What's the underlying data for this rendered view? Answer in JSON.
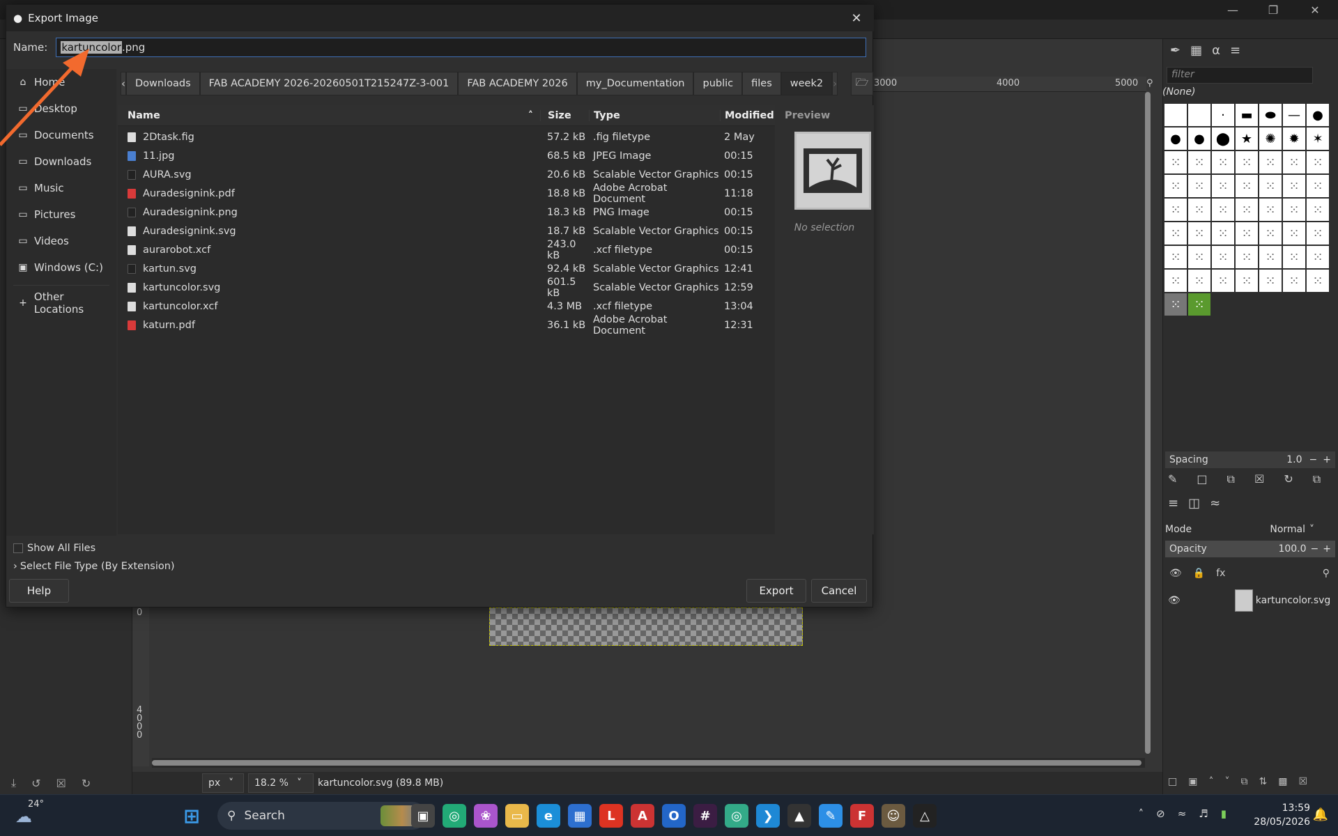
{
  "dialog": {
    "title": "Export Image",
    "name_label": "Name:",
    "name_selected": "kartuncolor",
    "name_rest": ".png",
    "places": [
      {
        "icon": "home-icon",
        "label": "Home"
      },
      {
        "icon": "folder-icon",
        "label": "Desktop"
      },
      {
        "icon": "folder-icon",
        "label": "Documents"
      },
      {
        "icon": "folder-icon",
        "label": "Downloads"
      },
      {
        "icon": "folder-icon",
        "label": "Music"
      },
      {
        "icon": "folder-icon",
        "label": "Pictures"
      },
      {
        "icon": "folder-icon",
        "label": "Videos"
      },
      {
        "icon": "drive-icon",
        "label": "Windows (C:)"
      }
    ],
    "other_locations": "Other Locations",
    "path": [
      "Downloads",
      "FAB ACADEMY 2026-20260501T215247Z-3-001",
      "FAB ACADEMY 2026",
      "my_Documentation",
      "public",
      "files",
      "week2"
    ],
    "columns": {
      "name": "Name",
      "size": "Size",
      "type": "Type",
      "modified": "Modified"
    },
    "files": [
      {
        "name": "2Dtask.fig",
        "size": "57.2 kB",
        "type": ".fig filetype",
        "modified": "2 May",
        "icon": "doc"
      },
      {
        "name": "11.jpg",
        "size": "68.5 kB",
        "type": "JPEG Image",
        "modified": "00:15",
        "icon": "img"
      },
      {
        "name": "AURA.svg",
        "size": "20.6 kB",
        "type": "Scalable Vector Graphics",
        "modified": "00:15",
        "icon": "dark"
      },
      {
        "name": "Auradesignink.pdf",
        "size": "18.8 kB",
        "type": "Adobe Acrobat Document",
        "modified": "11:18",
        "icon": "pdf"
      },
      {
        "name": "Auradesignink.png",
        "size": "18.3 kB",
        "type": "PNG Image",
        "modified": "00:15",
        "icon": "dark"
      },
      {
        "name": "Auradesignink.svg",
        "size": "18.7 kB",
        "type": "Scalable Vector Graphics",
        "modified": "00:15",
        "icon": "doc"
      },
      {
        "name": "aurarobot.xcf",
        "size": "243.0 kB",
        "type": ".xcf filetype",
        "modified": "00:15",
        "icon": "doc"
      },
      {
        "name": "kartun.svg",
        "size": "92.4 kB",
        "type": "Scalable Vector Graphics",
        "modified": "12:41",
        "icon": "dark"
      },
      {
        "name": "kartuncolor.svg",
        "size": "601.5 kB",
        "type": "Scalable Vector Graphics",
        "modified": "12:59",
        "icon": "doc"
      },
      {
        "name": "kartuncolor.xcf",
        "size": "4.3 MB",
        "type": ".xcf filetype",
        "modified": "13:04",
        "icon": "doc"
      },
      {
        "name": "katurn.pdf",
        "size": "36.1 kB",
        "type": "Adobe Acrobat Document",
        "modified": "12:31",
        "icon": "pdf"
      }
    ],
    "preview_title": "Preview",
    "preview_text": "No selection",
    "show_all_files": "Show All Files",
    "select_file_type": "Select File Type (By Extension)",
    "help": "Help",
    "export": "Export",
    "cancel": "Cancel"
  },
  "gimp": {
    "ruler_labels": [
      "3000",
      "4000",
      "5000"
    ],
    "vruler_labels": [
      "0",
      "4",
      "0",
      "0",
      "0"
    ],
    "unit": "px",
    "zoom": "18.2 %",
    "status_text": "kartuncolor.svg (89.8 MB)",
    "brush_filter_placeholder": "filter",
    "brush_name": "(None)",
    "spacing_label": "Spacing",
    "spacing_value": "1.0",
    "mode_label": "Mode",
    "mode_value": "Normal",
    "opacity_label": "Opacity",
    "opacity_value": "100.0",
    "layer_name": "kartuncolor.svg"
  },
  "taskbar": {
    "temperature": "24°",
    "search": "Search",
    "time": "13:59",
    "date": "28/05/2026"
  },
  "colors": {
    "accent_arrow": "#f26a2e",
    "selection_border": "#3e6fb5"
  }
}
